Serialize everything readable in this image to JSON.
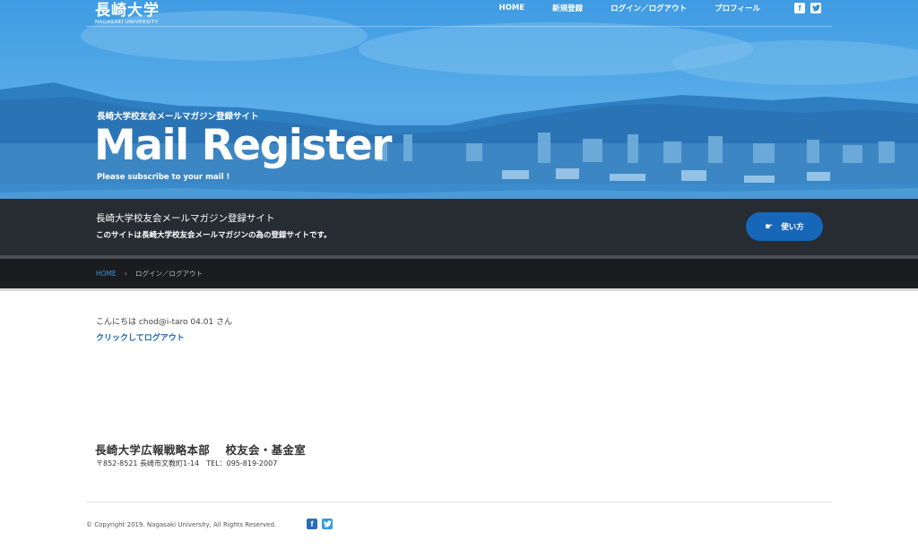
{
  "header": {
    "brand_kanji": "長崎大学",
    "brand_en": "NAGASAKI UNIVERSITY",
    "nav": [
      {
        "label": "HOME"
      },
      {
        "label": "新規登録"
      },
      {
        "label": "ログイン／ログアウト"
      },
      {
        "label": "プロフィール"
      }
    ],
    "social": {
      "facebook_glyph": "f",
      "twitter_glyph": "🐦"
    }
  },
  "hero": {
    "subtitle": "長崎大学校友会メールマガジン登録サイト",
    "title": "Mail Register",
    "tagline": "Please subscribe to your mail !"
  },
  "infobar": {
    "title": "長崎大学校友会メールマガジン登録サイト",
    "description": "このサイトは長崎大学校友会メールマガジンの為の登録サイトです。",
    "howto_button": "使い方",
    "howto_icon": "hand-pointing-icon"
  },
  "breadcrumb": {
    "home": "HOME",
    "separator": "›",
    "current": "ログイン／ログアウト"
  },
  "main": {
    "greeting": "こんにちは chod@i-taro 04.01 さん",
    "logout_link": "クリックしてログアウト"
  },
  "footer": {
    "org": "長崎大学広報戦略本部　 校友会・基金室",
    "address": "〒852-8521 長崎市文教町1-14　TEL：095-819-2007",
    "copyright": "© Copyright 2019. Nagasaki University, All Rights Reserved."
  },
  "colors": {
    "accent": "#1767b8",
    "infobar_bg": "#272b32",
    "breadcrumb_bg": "#1a1c20",
    "link": "#3f96dc"
  }
}
